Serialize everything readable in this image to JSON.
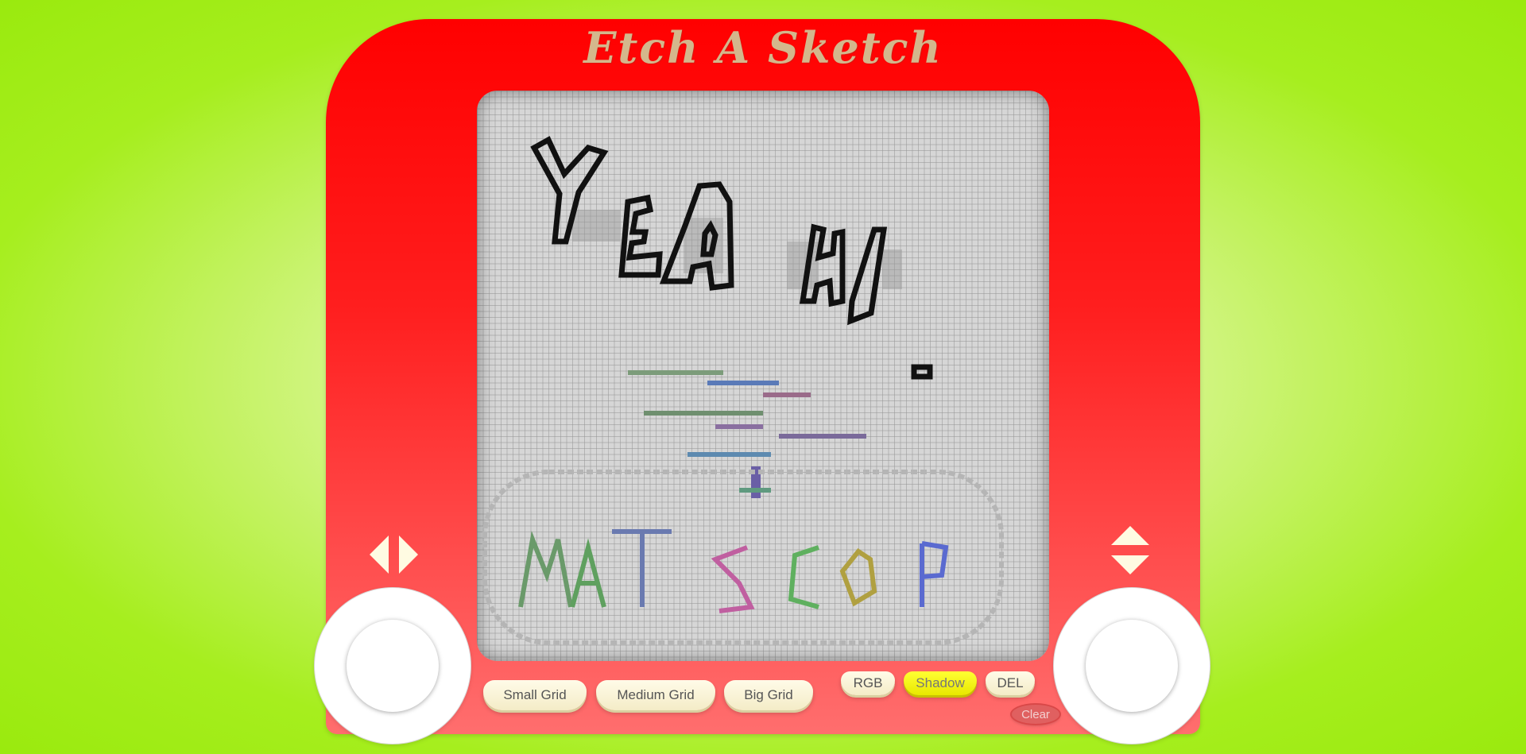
{
  "app": {
    "title": "Etch A Sketch"
  },
  "screen": {
    "drawing_heading": "YEAH!",
    "drawing_signature": "MATSCOP"
  },
  "controls": {
    "grid_buttons": [
      {
        "label": "Small Grid",
        "active": false
      },
      {
        "label": "Medium Grid",
        "active": false
      },
      {
        "label": "Big Grid",
        "active": false
      }
    ],
    "mode_buttons": [
      {
        "label": "RGB",
        "active": false
      },
      {
        "label": "Shadow",
        "active": true
      },
      {
        "label": "DEL",
        "active": false
      }
    ],
    "clear_label": "Clear"
  },
  "icons": {
    "left_arrow": "arrow-left-icon",
    "right_arrow": "arrow-right-icon",
    "up_arrow": "arrow-up-icon",
    "down_arrow": "arrow-down-icon"
  },
  "colors": {
    "frame": "#ff0000",
    "title": "#d4b78c",
    "screen": "#d6d6d6",
    "active_button": "#ffff33",
    "clear_button": "#e06060"
  }
}
